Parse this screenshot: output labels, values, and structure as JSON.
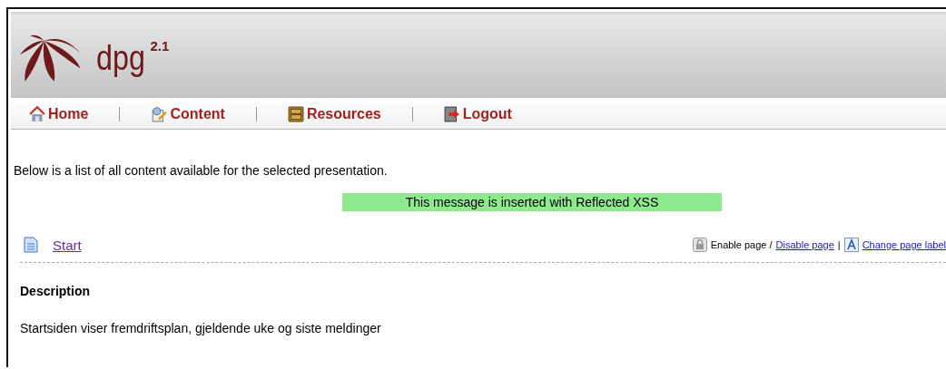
{
  "logo": {
    "name": "dpg",
    "version": "2.1"
  },
  "nav": [
    {
      "label": "Home",
      "kind": "home"
    },
    {
      "label": "Content",
      "kind": "content"
    },
    {
      "label": "Resources",
      "kind": "resources"
    },
    {
      "label": "Logout",
      "kind": "logout"
    }
  ],
  "intro": "Below is a list of all content available for the selected presentation.",
  "message": "This message is inserted with Reflected XSS",
  "page": {
    "title": "Start",
    "enable_label": "Enable page /",
    "disable_link": "Disable page",
    "separator": "|",
    "change_label_link": "Change page label"
  },
  "description": {
    "heading": "Description",
    "text": "Startsiden viser fremdriftsplan, gjeldende uke og siste meldinger"
  }
}
